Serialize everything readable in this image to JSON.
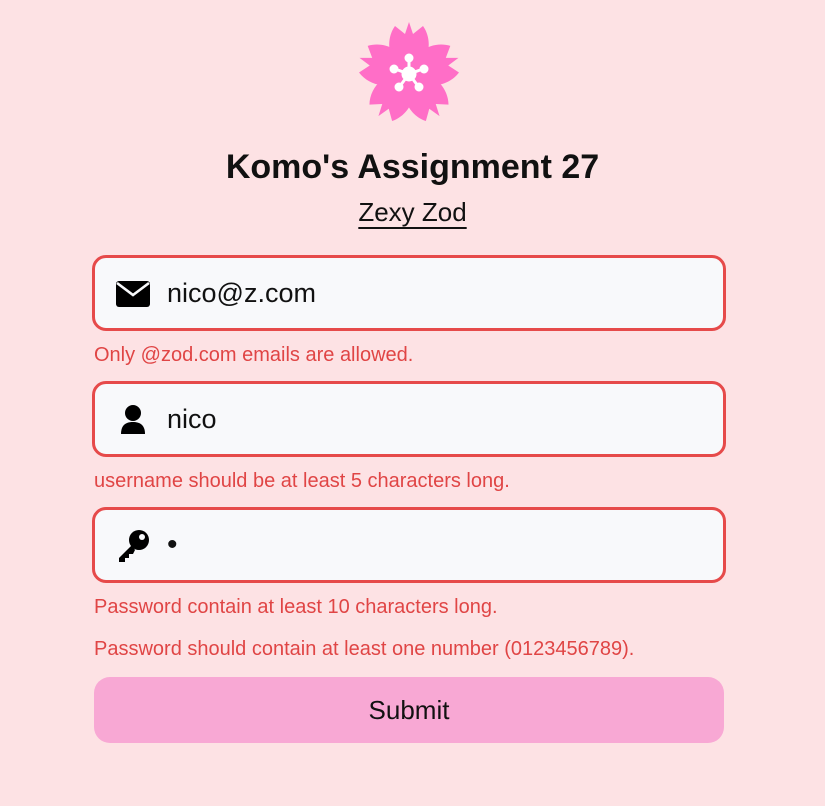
{
  "header": {
    "logo_icon": "cherry-blossom-icon",
    "logo_color": "#ff6ec7",
    "title": "Komo's Assignment 27",
    "subtitle": "Zexy Zod"
  },
  "form": {
    "email": {
      "icon": "envelope-icon",
      "value": "nico@z.com",
      "error": "Only @zod.com emails are allowed."
    },
    "username": {
      "icon": "user-icon",
      "value": "nico",
      "error": "username should be at least 5 characters long."
    },
    "password": {
      "icon": "key-icon",
      "value": "•",
      "errors": [
        "Password contain at least 10 characters long.",
        "Password should contain at least one number (0123456789)."
      ]
    },
    "submit_label": "Submit"
  },
  "colors": {
    "background": "#fde2e4",
    "error": "#e64a4a",
    "input_background": "#f8f9fb",
    "button": "#f8a8d4"
  }
}
